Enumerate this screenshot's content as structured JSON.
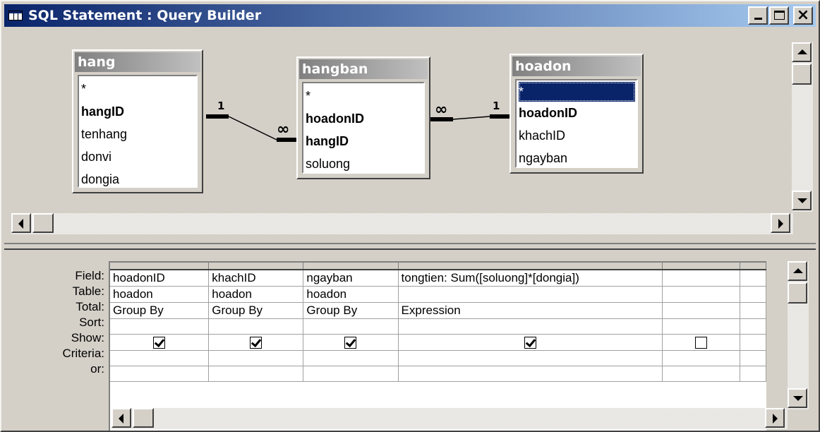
{
  "window": {
    "title": "SQL Statement : Query Builder",
    "title_icon": "query-grid-icon",
    "close_glyph": "×"
  },
  "diagram": {
    "tables": [
      {
        "name": "hang",
        "fields": [
          {
            "label": "*",
            "bold": false,
            "selected": false
          },
          {
            "label": "hangID",
            "bold": true,
            "selected": false
          },
          {
            "label": "tenhang",
            "bold": false,
            "selected": false
          },
          {
            "label": "donvi",
            "bold": false,
            "selected": false
          },
          {
            "label": "dongia",
            "bold": false,
            "selected": false
          }
        ]
      },
      {
        "name": "hangban",
        "fields": [
          {
            "label": "*",
            "bold": false,
            "selected": false
          },
          {
            "label": "hoadonID",
            "bold": true,
            "selected": false
          },
          {
            "label": "hangID",
            "bold": true,
            "selected": false
          },
          {
            "label": "soluong",
            "bold": false,
            "selected": false
          }
        ]
      },
      {
        "name": "hoadon",
        "fields": [
          {
            "label": "*",
            "bold": false,
            "selected": true
          },
          {
            "label": "hoadonID",
            "bold": true,
            "selected": false
          },
          {
            "label": "khachID",
            "bold": false,
            "selected": false
          },
          {
            "label": "ngayban",
            "bold": false,
            "selected": false
          }
        ]
      }
    ],
    "joins": [
      {
        "one_label": "1",
        "many_label": "∞"
      },
      {
        "one_label": "1",
        "many_label": "∞"
      }
    ]
  },
  "grid": {
    "row_labels": [
      "Field:",
      "Table:",
      "Total:",
      "Sort:",
      "Show:",
      "Criteria:",
      "or:"
    ],
    "columns": [
      {
        "field": "hoadonID",
        "table": "hoadon",
        "total": "Group By",
        "sort": "",
        "show": true,
        "criteria": "",
        "or": ""
      },
      {
        "field": "khachID",
        "table": "hoadon",
        "total": "Group By",
        "sort": "",
        "show": true,
        "criteria": "",
        "or": ""
      },
      {
        "field": "ngayban",
        "table": "hoadon",
        "total": "Group By",
        "sort": "",
        "show": true,
        "criteria": "",
        "or": ""
      },
      {
        "field": "tongtien: Sum([soluong]*[dongia])",
        "table": "",
        "total": "Expression",
        "sort": "",
        "show": true,
        "criteria": "",
        "or": ""
      },
      {
        "field": "",
        "table": "",
        "total": "",
        "sort": "",
        "show": false,
        "criteria": "",
        "or": ""
      },
      {
        "field": "",
        "table": "",
        "total": "",
        "sort": "",
        "show": null,
        "criteria": "",
        "or": ""
      }
    ]
  }
}
